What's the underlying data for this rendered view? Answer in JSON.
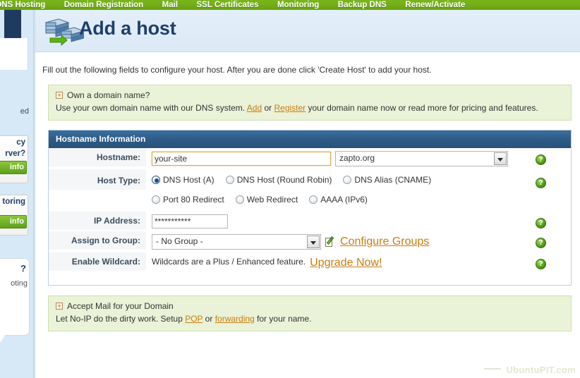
{
  "topnav": {
    "items": [
      {
        "label": "DNS Hosting"
      },
      {
        "label": "Domain Registration"
      },
      {
        "label": "Mail"
      },
      {
        "label": "SSL Certificates"
      },
      {
        "label": "Monitoring"
      },
      {
        "label": "Backup DNS"
      },
      {
        "label": "Renew/Activate"
      }
    ]
  },
  "sidebar": {
    "cut_text": "ed",
    "promos": [
      {
        "title_line1": "cy",
        "title_line2": "rver?",
        "button": "info"
      },
      {
        "title_line1": "toring",
        "title_line2": "",
        "button": "info"
      }
    ],
    "bubble": {
      "question": "?",
      "text": "oting"
    }
  },
  "page": {
    "title": "Add a host",
    "title_icon": "server-migration-icon",
    "intro": "Fill out the following fields to configure your host. After you are done click 'Create Host' to add your host."
  },
  "domain_callout": {
    "expand_icon": "+",
    "title": "Own a domain name?",
    "body_before": "Use your own domain name with our DNS system. ",
    "link_add": "Add",
    "body_mid": " or ",
    "link_register": "Register",
    "body_after": " your domain name now or read more for pricing and features."
  },
  "hostname_panel": {
    "header": "Hostname Information",
    "hostname": {
      "label": "Hostname:",
      "value": "your-site",
      "placeholder": "",
      "domain_selected": "zapto.org",
      "help_icon": "?"
    },
    "host_type": {
      "label": "Host Type:",
      "options_row1": [
        {
          "label": "DNS Host (A)",
          "selected": true
        },
        {
          "label": "DNS Host (Round Robin)",
          "selected": false
        },
        {
          "label": "DNS Alias (CNAME)",
          "selected": false
        }
      ],
      "options_row2": [
        {
          "label": "Port 80 Redirect",
          "selected": false
        },
        {
          "label": "Web Redirect",
          "selected": false
        },
        {
          "label": "AAAA (IPv6)",
          "selected": false
        }
      ],
      "help_icon": "?"
    },
    "ip_address": {
      "label": "IP Address:",
      "value": "***********",
      "help_icon": "?"
    },
    "assign_group": {
      "label": "Assign to Group:",
      "selected": "- No Group -",
      "configure_link": "Configure Groups",
      "edit_icon": "edit-notepad-icon",
      "help_icon": "?"
    },
    "enable_wildcard": {
      "label": "Enable Wildcard:",
      "text": "Wildcards are a Plus / Enhanced feature. ",
      "link": "Upgrade Now!",
      "help_icon": "?"
    }
  },
  "mail_callout": {
    "expand_icon": "+",
    "title": "Accept Mail for your Domain",
    "body_before": "Let No-IP do the dirty work. Setup ",
    "link_pop": "POP",
    "body_mid": " or ",
    "link_forwarding": "forwarding",
    "body_after": " for your name."
  },
  "watermark": "UbuntuPIT.com",
  "colors": {
    "nav_green": "#7ab51d",
    "panel_blue": "#2e5c87",
    "title_navy": "#1f3f6b",
    "callout_green_bg": "#eaf2d8",
    "link_orange": "#c87d0e",
    "focus_gold": "#d6a93f",
    "help_green": "#57a016"
  }
}
